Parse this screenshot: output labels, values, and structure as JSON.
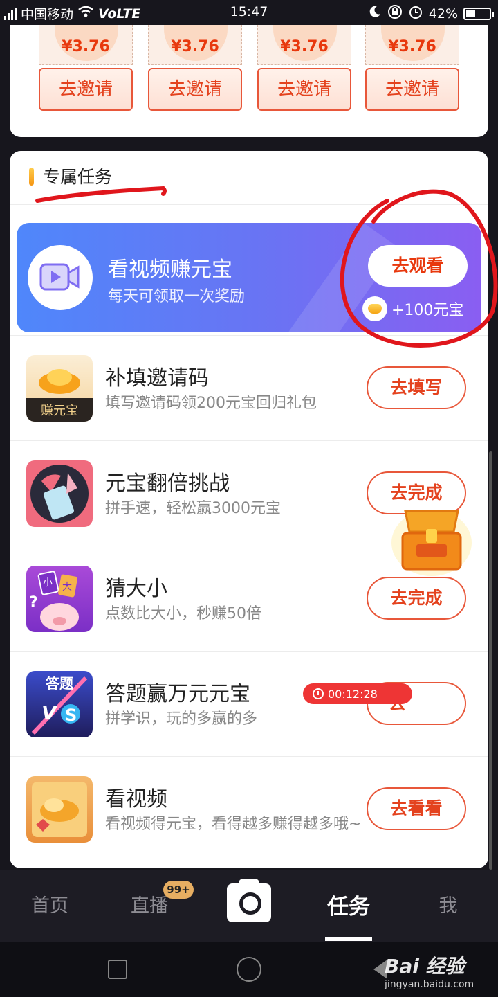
{
  "status_bar": {
    "carrier": "中国移动",
    "network": "VoLTE",
    "time": "15:47",
    "battery": "42%",
    "battery_level": 0.42
  },
  "invite": {
    "items": [
      {
        "price": "¥3.76",
        "button": "去邀请"
      },
      {
        "price": "¥3.76",
        "button": "去邀请"
      },
      {
        "price": "¥3.76",
        "button": "去邀请"
      },
      {
        "price": "¥3.76",
        "button": "去邀请"
      }
    ]
  },
  "section": {
    "title": "专属任务"
  },
  "banner": {
    "title": "看视频赚元宝",
    "subtitle": "每天可领取一次奖励",
    "button": "去观看",
    "reward": "+100元宝"
  },
  "tasks": [
    {
      "title": "补填邀请码",
      "desc": "填写邀请码领200元宝回归礼包",
      "button": "去填写",
      "icon_label": "赚元宝",
      "icon": "gold-ingot-icon"
    },
    {
      "title": "元宝翻倍挑战",
      "desc": "拼手速，轻松赢3000元宝",
      "button": "去完成",
      "icon": "fruit-slice-icon"
    },
    {
      "title": "猜大小",
      "desc": "点数比大小，秒赚50倍",
      "button": "去完成",
      "icon": "pig-dice-icon",
      "icon_chars": [
        "小",
        "大"
      ]
    },
    {
      "title": "答题赢万元元宝",
      "desc": "拼学识，玩的多赢的多",
      "button": "去",
      "icon": "quiz-vs-icon",
      "icon_label": "答题",
      "timer": "00:12:28"
    },
    {
      "title": "看视频",
      "desc": "看视频得元宝，看得越多赚得越多哦~",
      "button": "去看看",
      "icon": "gold-video-icon"
    }
  ],
  "tabbar": {
    "tabs": [
      "首页",
      "直播",
      "任务",
      "我"
    ],
    "badge": "99+",
    "active": "任务"
  },
  "watermark": {
    "logo": "Bai 经验",
    "url": "jingyan.baidu.com"
  },
  "colors": {
    "accent": "#e8380d",
    "banner_start": "#4f87fb",
    "banner_end": "#8a5ef2",
    "annotation": "#e0161c"
  }
}
